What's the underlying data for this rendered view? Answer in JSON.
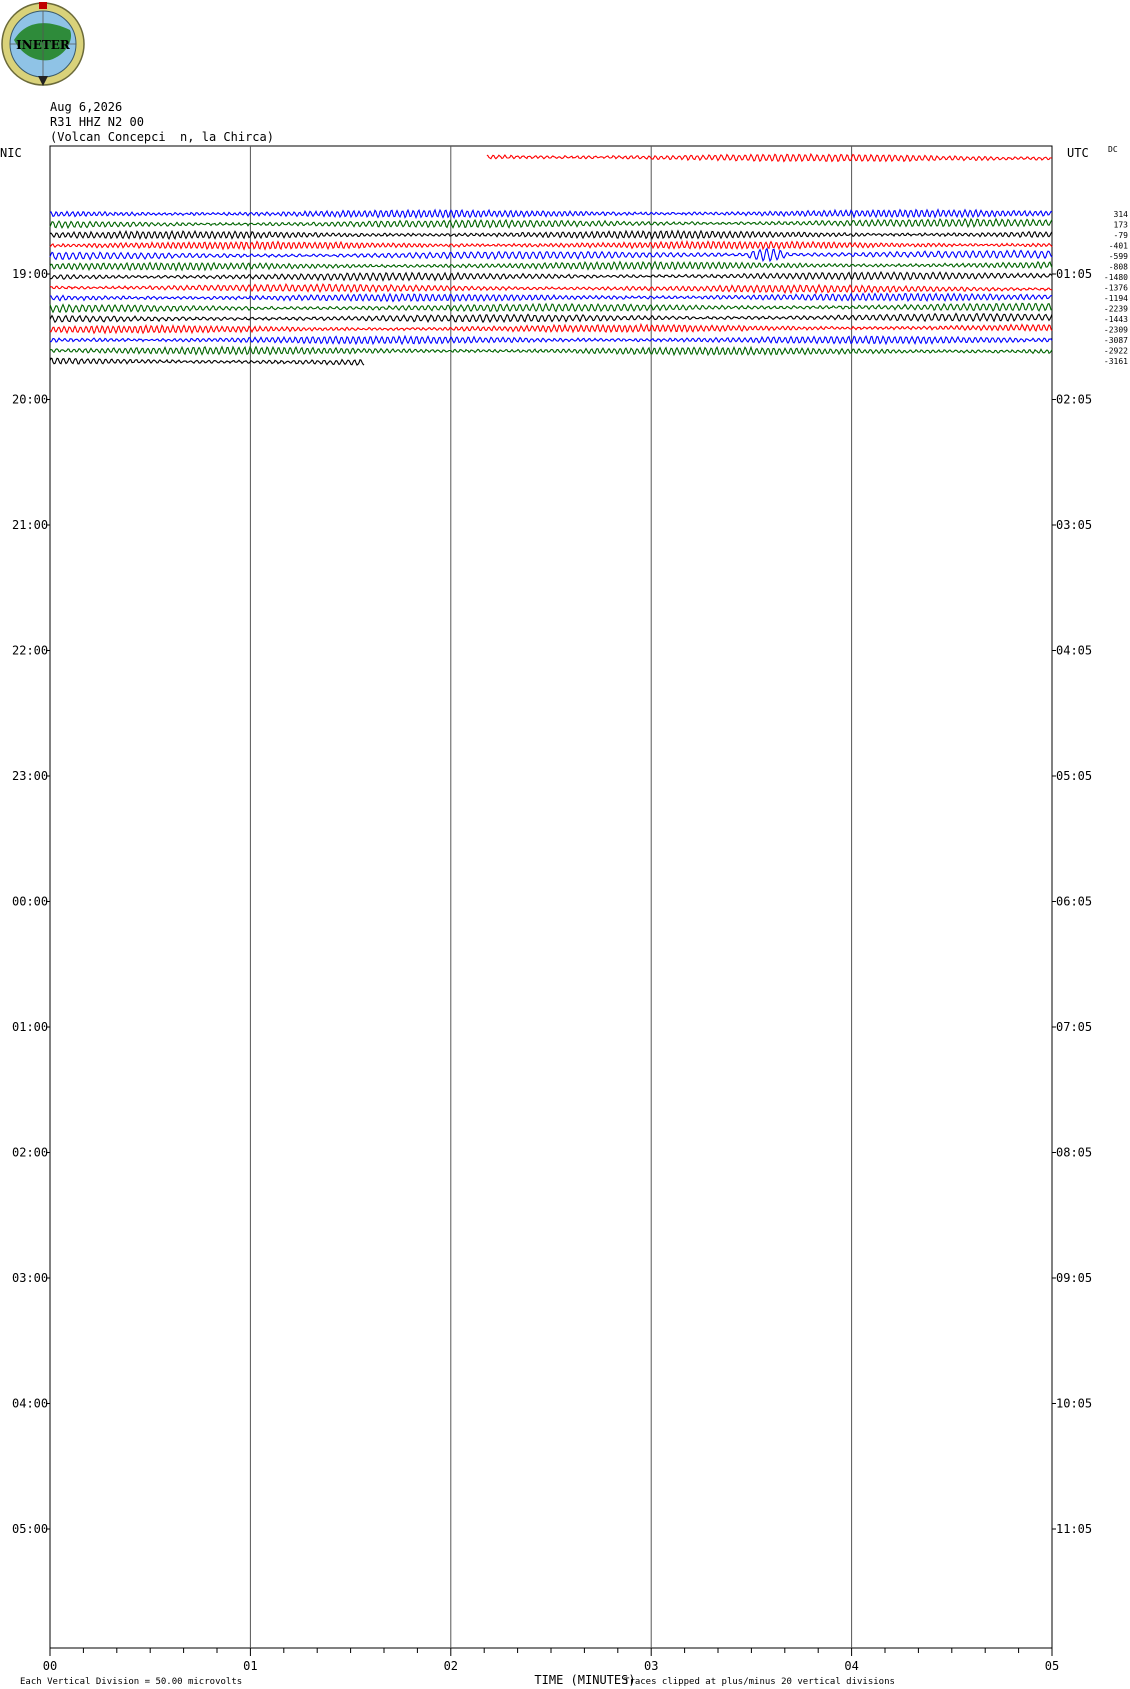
{
  "header": {
    "date": "Aug 6,2026",
    "channel": "R31 HHZ N2 00",
    "station": "(Volcan Concepci  n, la Chirca)",
    "logo_text": "INETER"
  },
  "axes": {
    "left_title": "NIC",
    "right_title": "UTC",
    "dc_title": "DC",
    "x_title": "TIME (MINUTES)",
    "left_labels": [
      "19:00",
      "20:00",
      "21:00",
      "22:00",
      "23:00",
      "00:00",
      "01:00",
      "02:00",
      "03:00",
      "04:00",
      "05:00"
    ],
    "right_labels": [
      "01:05",
      "02:05",
      "03:05",
      "04:05",
      "05:05",
      "06:05",
      "07:05",
      "08:05",
      "09:05",
      "10:05",
      "11:05"
    ],
    "x_labels": [
      "00",
      "01",
      "02",
      "03",
      "04",
      "05"
    ]
  },
  "footer": {
    "scale": "Each Vertical Division =   50.00 microvolts",
    "clip": "Traces clipped at plus/minus 20 vertical divisions"
  },
  "chart_data": {
    "type": "line",
    "title": "",
    "xlabel": "TIME (MINUTES)",
    "xlim": [
      0,
      5
    ],
    "trace_colors": [
      "#ff0000",
      "#0000ff",
      "#006400",
      "#000000"
    ],
    "traces": [
      {
        "color": "#ff0000",
        "start_min": 2.18,
        "end_min": 5.0,
        "dc": ""
      },
      {
        "color": "#0000ff",
        "start_min": 0,
        "end_min": 5.0,
        "dc": "314"
      },
      {
        "color": "#006400",
        "start_min": 0,
        "end_min": 5.0,
        "dc": "173"
      },
      {
        "color": "#000000",
        "start_min": 0,
        "end_min": 5.0,
        "dc": "-79"
      },
      {
        "color": "#ff0000",
        "start_min": 0,
        "end_min": 5.0,
        "dc": "-401"
      },
      {
        "color": "#0000ff",
        "start_min": 0,
        "end_min": 5.0,
        "dc": "-599"
      },
      {
        "color": "#006400",
        "start_min": 0,
        "end_min": 5.0,
        "dc": "-808"
      },
      {
        "color": "#000000",
        "start_min": 0,
        "end_min": 5.0,
        "dc": "-1480"
      },
      {
        "color": "#ff0000",
        "start_min": 0,
        "end_min": 5.0,
        "dc": "-1376"
      },
      {
        "color": "#0000ff",
        "start_min": 0,
        "end_min": 5.0,
        "dc": "-1194"
      },
      {
        "color": "#006400",
        "start_min": 0,
        "end_min": 5.0,
        "dc": "-2239"
      },
      {
        "color": "#000000",
        "start_min": 0,
        "end_min": 5.0,
        "dc": "-1443"
      },
      {
        "color": "#ff0000",
        "start_min": 0,
        "end_min": 5.0,
        "dc": "-2309"
      },
      {
        "color": "#0000ff",
        "start_min": 0,
        "end_min": 5.0,
        "dc": "-3087"
      },
      {
        "color": "#006400",
        "start_min": 0,
        "end_min": 5.0,
        "dc": "-2922"
      },
      {
        "color": "#000000",
        "start_min": 0,
        "end_min": 1.57,
        "dc": "-3161"
      }
    ]
  }
}
